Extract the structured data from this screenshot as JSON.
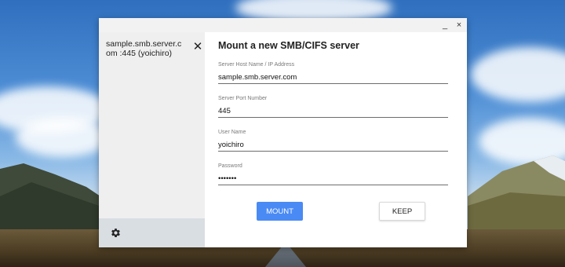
{
  "window": {
    "minimize_glyph": "_",
    "close_glyph": "×"
  },
  "sidebar": {
    "server_entry": "sample.smb.server.com :445 (yoichiro)",
    "entry_close_glyph": "✕",
    "settings_icon": "gear-icon"
  },
  "form": {
    "title": "Mount a new SMB/CIFS server",
    "host": {
      "label": "Server Host Name / IP Address",
      "value": "sample.smb.server.com"
    },
    "port": {
      "label": "Server Port Number",
      "value": "445"
    },
    "user": {
      "label": "User Name",
      "value": "yoichiro"
    },
    "password": {
      "label": "Password",
      "value": "•••••••"
    },
    "mount_label": "MOUNT",
    "keep_label": "KEEP"
  },
  "colors": {
    "mount_button": "#4a8af4",
    "sidebar_background": "#efefef",
    "sidebar_footer": "#d9dee3"
  }
}
